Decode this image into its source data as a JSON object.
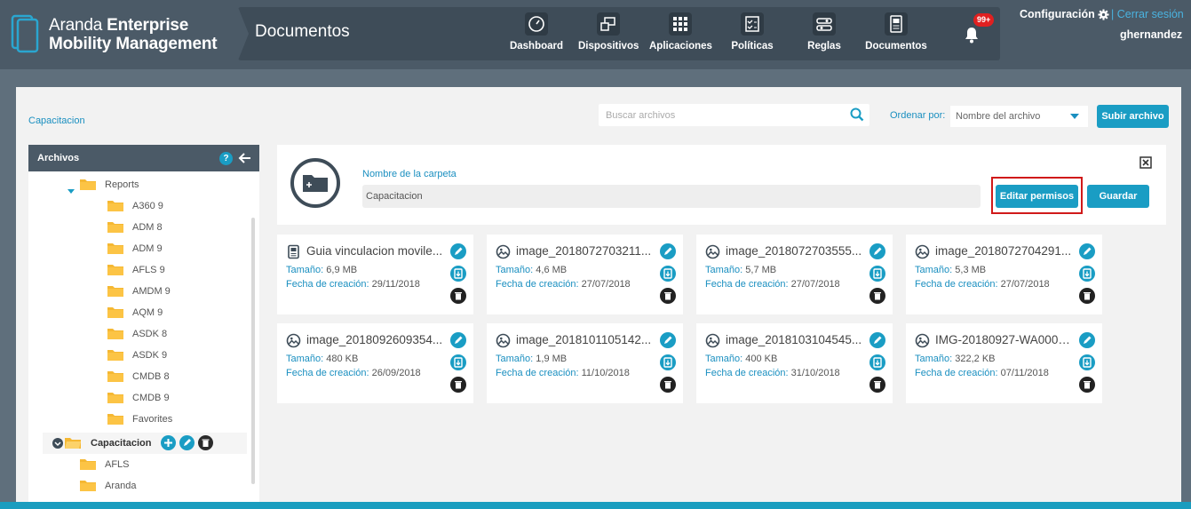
{
  "header": {
    "logo_light": "Aranda ",
    "logo_bold_1": "Enterprise",
    "logo_bold_2": "Mobility Management",
    "page_title": "Documentos",
    "nav": [
      {
        "label": "Dashboard",
        "icon": "gauge-icon"
      },
      {
        "label": "Dispositivos",
        "icon": "devices-icon"
      },
      {
        "label": "Aplicaciones",
        "icon": "grid-icon"
      },
      {
        "label": "Políticas",
        "icon": "checklist-icon"
      },
      {
        "label": "Reglas",
        "icon": "rules-icon"
      },
      {
        "label": "Documentos",
        "icon": "document-icon"
      }
    ],
    "notifications_badge": "99+",
    "config_label": "Configuración",
    "logout_label": "Cerrar sesión",
    "username": "ghernandez"
  },
  "toolbar": {
    "breadcrumb": "Capacitacion",
    "search_placeholder": "Buscar archivos",
    "order_label": "Ordenar por:",
    "order_value": "Nombre del archivo",
    "upload_label": "Subir archivo"
  },
  "sidebar": {
    "title": "Archivos",
    "help": "?",
    "tree": [
      "Reports",
      "A360 9",
      "ADM 8",
      "ADM 9",
      "AFLS 9",
      "AMDM 9",
      "AQM 9",
      "ASDK 8",
      "ASDK 9",
      "CMDB 8",
      "CMDB 9",
      "Favorites"
    ],
    "selected": "Capacitacion",
    "children": [
      "AFLS",
      "Aranda"
    ]
  },
  "folder_panel": {
    "name_label": "Nombre de la carpeta",
    "name_value": "Capacitacion",
    "edit_permissions_label": "Editar permisos",
    "save_label": "Guardar"
  },
  "files": [
    {
      "name": "Guia vinculacion movile...",
      "type": "document",
      "size_label": "Tamaño:",
      "size": "6,9 MB",
      "date_label": "Fecha de creación:",
      "date": "29/11/2018"
    },
    {
      "name": "image_2018072703211...",
      "type": "image",
      "size_label": "Tamaño:",
      "size": "4,6 MB",
      "date_label": "Fecha de creación:",
      "date": "27/07/2018"
    },
    {
      "name": "image_2018072703555...",
      "type": "image",
      "size_label": "Tamaño:",
      "size": "5,7 MB",
      "date_label": "Fecha de creación:",
      "date": "27/07/2018"
    },
    {
      "name": "image_2018072704291...",
      "type": "image",
      "size_label": "Tamaño:",
      "size": "5,3 MB",
      "date_label": "Fecha de creación:",
      "date": "27/07/2018"
    },
    {
      "name": "image_2018092609354...",
      "type": "image",
      "size_label": "Tamaño:",
      "size": "480 KB",
      "date_label": "Fecha de creación:",
      "date": "26/09/2018"
    },
    {
      "name": "image_2018101105142...",
      "type": "image",
      "size_label": "Tamaño:",
      "size": "1,9 MB",
      "date_label": "Fecha de creación:",
      "date": "11/10/2018"
    },
    {
      "name": "image_2018103104545...",
      "type": "image",
      "size_label": "Tamaño:",
      "size": "400 KB",
      "date_label": "Fecha de creación:",
      "date": "31/10/2018"
    },
    {
      "name": "IMG-20180927-WA0006...",
      "type": "image",
      "size_label": "Tamaño:",
      "size": "322,2 KB",
      "date_label": "Fecha de creación:",
      "date": "07/11/2018"
    }
  ],
  "colors": {
    "accent": "#1a9dc4",
    "header": "#4b5a67",
    "folder": "#f5b833",
    "highlight": "#d01a1a"
  }
}
